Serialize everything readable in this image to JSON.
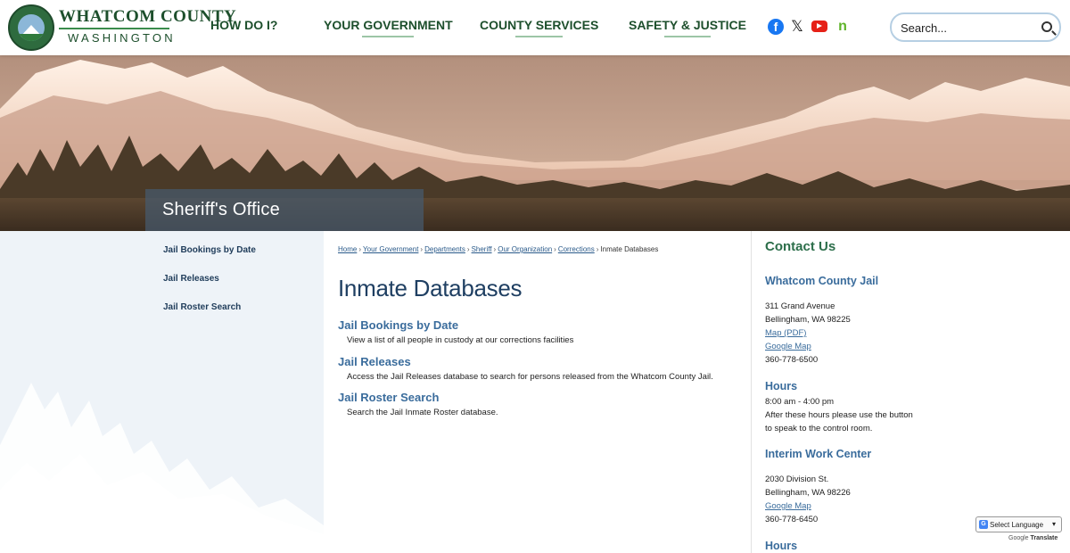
{
  "header": {
    "logo_title": "WHATCOM COUNTY",
    "logo_subtitle": "WASHINGTON",
    "nav": [
      {
        "label": "HOW DO I?"
      },
      {
        "label": "YOUR GOVERNMENT"
      },
      {
        "label": "COUNTY SERVICES"
      },
      {
        "label": "SAFETY & JUSTICE"
      }
    ],
    "social": [
      "facebook-icon",
      "x-icon",
      "youtube-icon",
      "nextdoor-icon"
    ],
    "search_placeholder": "Search..."
  },
  "hero": {
    "banner_title": "Sheriff's Office"
  },
  "sidebar": {
    "items": [
      {
        "label": "Jail Bookings by Date"
      },
      {
        "label": "Jail Releases"
      },
      {
        "label": "Jail Roster Search"
      }
    ]
  },
  "breadcrumbs": {
    "links": [
      "Home",
      "Your Government",
      "Departments",
      "Sheriff",
      "Our Organization",
      "Corrections"
    ],
    "current": "Inmate Databases"
  },
  "main": {
    "title": "Inmate Databases",
    "entries": [
      {
        "label": "Jail Bookings by Date",
        "description": "View a list of all people in custody at our corrections facilities"
      },
      {
        "label": "Jail Releases",
        "description": "Access the Jail Releases database to search for persons released from the Whatcom County Jail."
      },
      {
        "label": "Jail Roster Search",
        "description": "Search the Jail Inmate Roster database."
      }
    ]
  },
  "contact": {
    "heading": "Contact Us",
    "jail": {
      "name": "Whatcom County Jail",
      "address1": "311 Grand Avenue",
      "address2": "Bellingham, WA 98225",
      "map_pdf": "Map (PDF)",
      "google_map": "Google Map",
      "phone": "360-778-6500"
    },
    "hours": {
      "title": "Hours",
      "time": "8:00 am - 4:00 pm",
      "note1": "After these hours please use the button",
      "note2": "to speak to the control room."
    },
    "work_center": {
      "name": "Interim Work Center",
      "address1": "2030 Division St.",
      "address2": "Bellingham, WA 98226",
      "google_map": "Google Map",
      "phone": "360-778-6450"
    },
    "hours2_title": "Hours"
  },
  "translate": {
    "select_label": "Select Language",
    "powered_by": "Google",
    "translate_label": "Translate"
  },
  "colors": {
    "brand_green": "#1d4f2c",
    "link_blue": "#3a6c9c",
    "title_blue": "#1f3f62",
    "contact_green": "#2c6e4a"
  }
}
